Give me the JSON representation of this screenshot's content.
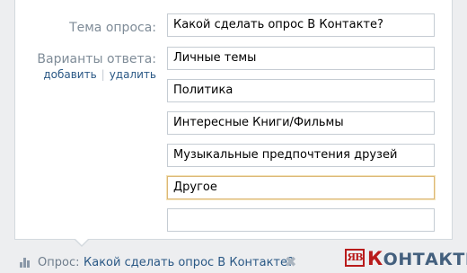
{
  "form": {
    "topic_label": "Тема опроса:",
    "topic_value": "Какой сделать опрос В Контакте?",
    "answers_label": "Варианты ответа:",
    "add_label": "добавить",
    "separator": "|",
    "remove_label": "удалить",
    "answers": [
      "Личные темы",
      "Политика",
      "Интересные Книги/Фильмы",
      "Музыкальные предпочтения друзей",
      "Другое",
      ""
    ],
    "focused_answer_index": 4
  },
  "footer": {
    "prefix": "Опрос:",
    "poll_title": "Какой сделать опрос В Контакте?",
    "poll_icon": "bar-chart-icon",
    "remove_icon": "close-icon"
  },
  "brand": {
    "badge": "ЯВ",
    "first_letter": "К",
    "rest": "ОНТАКТЕ"
  },
  "colors": {
    "link": "#2a5885",
    "label": "#7f8c98",
    "focus_border": "#dcb776",
    "brand_red": "#b91b1b",
    "brand_blue": "#44607e"
  }
}
